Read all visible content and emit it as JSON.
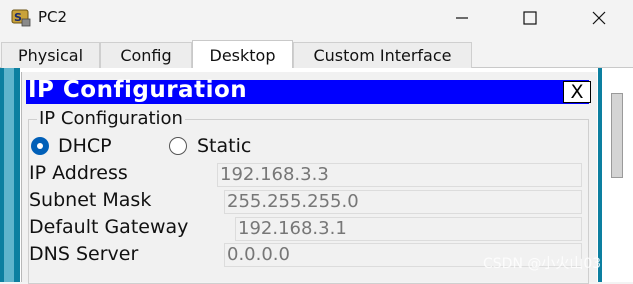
{
  "window": {
    "title": "PC2"
  },
  "tabs": [
    {
      "label": "Physical"
    },
    {
      "label": "Config"
    },
    {
      "label": "Desktop"
    },
    {
      "label": "Custom Interface"
    }
  ],
  "active_tab": "Desktop",
  "dialog": {
    "title": "IP Configuration",
    "close_label": "X"
  },
  "ip_config": {
    "group_title": "IP Configuration",
    "mode_options": [
      {
        "label": "DHCP"
      },
      {
        "label": "Static"
      }
    ],
    "selected_mode": "DHCP",
    "fields": [
      {
        "label": "IP Address",
        "value": "192.168.3.3"
      },
      {
        "label": "Subnet Mask",
        "value": "255.255.255.0"
      },
      {
        "label": "Default Gateway",
        "value": "192.168.3.1"
      },
      {
        "label": "DNS Server",
        "value": "0.0.0.0"
      }
    ]
  },
  "watermark": "CSDN @小火山03",
  "colors": {
    "dialog_title_bg": "#0000ff",
    "radio_selected": "#005fb8",
    "frame_teal": "#0c7fa0"
  }
}
